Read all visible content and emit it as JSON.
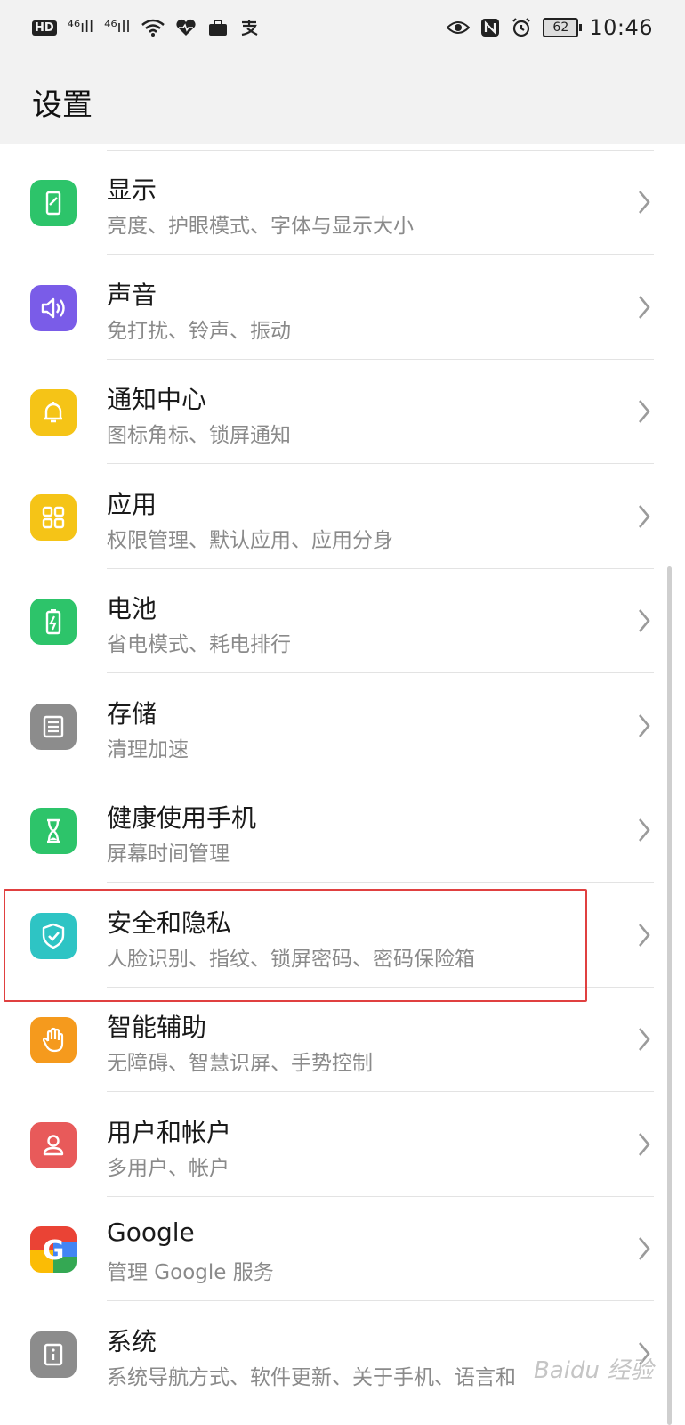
{
  "status_bar": {
    "hd": "HD",
    "signal1": "⁴⁶ıll",
    "signal2": "⁴⁶ıll",
    "battery": "62",
    "time": "10:46"
  },
  "header": {
    "title": "设置"
  },
  "settings": [
    {
      "title": "显示",
      "subtitle": "亮度、护眼模式、字体与显示大小",
      "icon": "display-icon",
      "color": "#2dc46a"
    },
    {
      "title": "声音",
      "subtitle": "免打扰、铃声、振动",
      "icon": "sound-icon",
      "color": "#7a5ce8"
    },
    {
      "title": "通知中心",
      "subtitle": "图标角标、锁屏通知",
      "icon": "bell-icon",
      "color": "#f5c417"
    },
    {
      "title": "应用",
      "subtitle": "权限管理、默认应用、应用分身",
      "icon": "apps-grid-icon",
      "color": "#f5c417"
    },
    {
      "title": "电池",
      "subtitle": "省电模式、耗电排行",
      "icon": "battery-icon",
      "color": "#2dc46a"
    },
    {
      "title": "存储",
      "subtitle": "清理加速",
      "icon": "storage-icon",
      "color": "#8c8c8c"
    },
    {
      "title": "健康使用手机",
      "subtitle": "屏幕时间管理",
      "icon": "hourglass-icon",
      "color": "#2dc46a"
    },
    {
      "title": "安全和隐私",
      "subtitle": "人脸识别、指纹、锁屏密码、密码保险箱",
      "icon": "shield-icon",
      "color": "#2ec4c4"
    },
    {
      "title": "智能辅助",
      "subtitle": "无障碍、智慧识屏、手势控制",
      "icon": "hand-icon",
      "color": "#f59a1d"
    },
    {
      "title": "用户和帐户",
      "subtitle": "多用户、帐户",
      "icon": "user-icon",
      "color": "#e85a5a"
    },
    {
      "title": "Google",
      "subtitle": "管理 Google 服务",
      "icon": "google-icon",
      "color": "#ea4335"
    },
    {
      "title": "系统",
      "subtitle": "系统导航方式、软件更新、关于手机、语言和",
      "icon": "info-icon",
      "color": "#8c8c8c"
    }
  ],
  "watermark": "Baidu 经验"
}
